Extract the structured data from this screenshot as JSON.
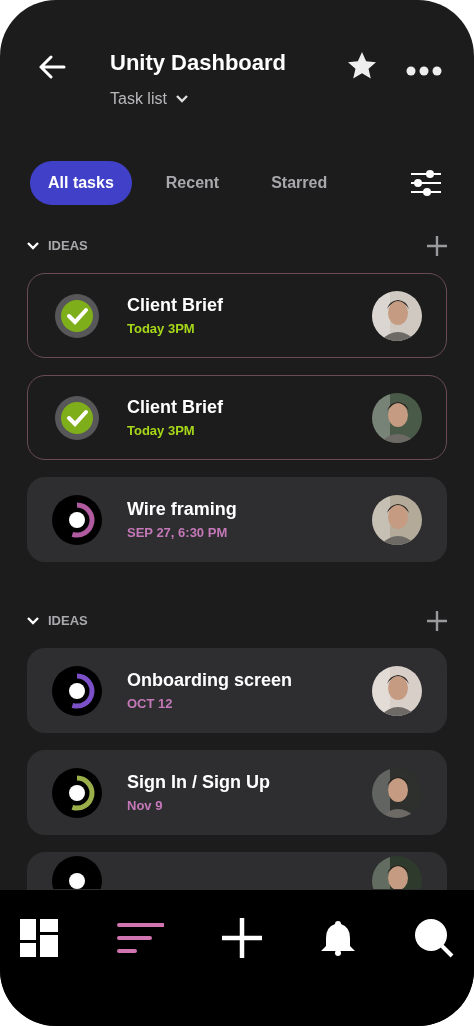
{
  "header": {
    "title": "Unity Dashboard",
    "subtitle": "Task list"
  },
  "tabs": [
    {
      "label": "All tasks",
      "selected": true
    },
    {
      "label": "Recent",
      "selected": false
    },
    {
      "label": "Starred",
      "selected": false
    }
  ],
  "sections": [
    {
      "title": "IDEAS",
      "expanded": true,
      "tasks": [
        {
          "title": "Client Brief",
          "due": "Today 3PM",
          "done": true,
          "bordered": true
        },
        {
          "title": "Client Brief",
          "due": "Today 3PM",
          "done": true,
          "bordered": true
        },
        {
          "title": "Wire framing",
          "due": "SEP 27, 6:30 PM",
          "done": false,
          "bordered": false,
          "color": "#b05aa0"
        }
      ]
    },
    {
      "title": "IDEAS",
      "expanded": true,
      "tasks": [
        {
          "title": "Onboarding screen",
          "due": "OCT 12",
          "done": false,
          "bordered": false,
          "color": "#7a4fc8"
        },
        {
          "title": "Sign In / Sign Up",
          "due": "Nov 9",
          "done": false,
          "bordered": false,
          "color": "#9aae4a"
        },
        {
          "kind": "partial"
        }
      ]
    }
  ],
  "nav": [
    {
      "kind": "dashboard",
      "selected": false
    },
    {
      "kind": "list",
      "selected": true
    },
    {
      "kind": "add",
      "selected": false
    },
    {
      "kind": "bell",
      "selected": false
    },
    {
      "kind": "search",
      "selected": false
    }
  ]
}
